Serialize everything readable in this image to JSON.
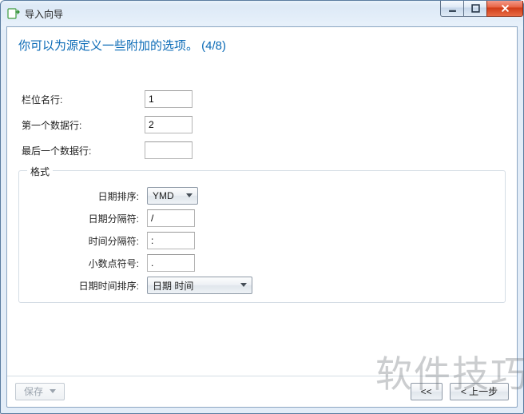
{
  "window": {
    "title": "导入向导"
  },
  "heading": "你可以为源定义一些附加的选项。 (4/8)",
  "fields": {
    "header_row": {
      "label": "栏位名行:",
      "value": "1"
    },
    "first_data_row": {
      "label": "第一个数据行:",
      "value": "2"
    },
    "last_data_row": {
      "label": "最后一个数据行:",
      "value": ""
    }
  },
  "format": {
    "legend": "格式",
    "date_order": {
      "label": "日期排序:",
      "value": "YMD"
    },
    "date_sep": {
      "label": "日期分隔符:",
      "value": "/"
    },
    "time_sep": {
      "label": "时间分隔符:",
      "value": ":"
    },
    "dec_sym": {
      "label": "小数点符号:",
      "value": "."
    },
    "dt_order": {
      "label": "日期时间排序:",
      "value": "日期 时间"
    }
  },
  "footer": {
    "save": "保存",
    "prev_icon": "<<",
    "prev": "< 上一步"
  },
  "watermark": "软件技巧"
}
